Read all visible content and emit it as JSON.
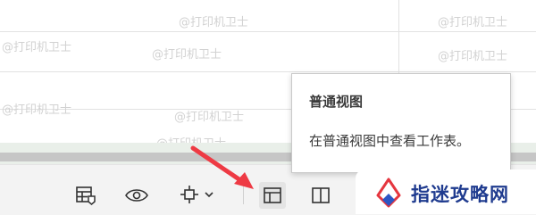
{
  "watermark": {
    "text": "@打印机卫士"
  },
  "status_bar": {
    "buttons": [
      {
        "name": "page-layout-icon"
      },
      {
        "name": "reading-view-icon"
      },
      {
        "name": "focus-mode-icon"
      },
      {
        "name": "normal-view-icon",
        "active": true
      },
      {
        "name": "page-break-icon"
      }
    ]
  },
  "tooltip": {
    "title": "普通视图",
    "body": "在普通视图中查看工作表。"
  },
  "logo": {
    "text": "指迷攻略网"
  },
  "colors": {
    "arrow": "#ee3a44",
    "logo_text": "#1f3b8f",
    "scroll_track": "#e9efe9"
  }
}
